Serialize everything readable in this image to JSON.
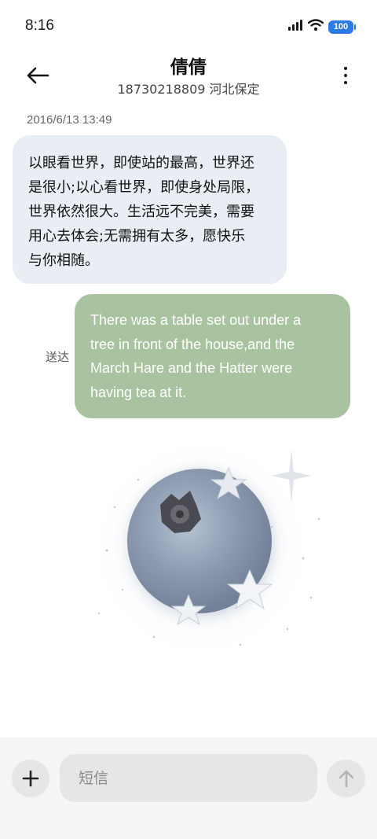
{
  "status_bar": {
    "time": "8:16",
    "battery": "100",
    "icons": [
      "signal-icon",
      "wifi-icon",
      "battery-icon"
    ]
  },
  "header": {
    "contact_name": "倩倩",
    "contact_sub": "18730218809 河北保定",
    "back_icon": "arrow-left-icon",
    "more_icon": "more-vertical-icon"
  },
  "conversation": {
    "timestamp": "2016/6/13 13:49",
    "incoming": {
      "lines": [
        "以眼看世界，即使站的最高，世界还",
        "是很小;以心看世界，即使身处局限，",
        "世界依然很大。生活远不完美，需要",
        "用心去体会;无需拥有太多，愿快乐",
        "与你相随。"
      ]
    },
    "outgoing": {
      "lines": [
        "There was a table set out under a",
        "tree in front of the house,and the",
        "March Hare and the Hatter were",
        "having tea at it."
      ],
      "status": "送达"
    },
    "image_message": {
      "subject": "blueberry with stars"
    }
  },
  "input_bar": {
    "placeholder": "短信",
    "add_icon": "plus-icon",
    "send_icon": "arrow-up-icon"
  },
  "colors": {
    "incoming_bubble": "#e9eef5",
    "outgoing_bubble": "#a9c3a0",
    "battery": "#2a7be4",
    "input_bg": "#f5f5f5"
  }
}
